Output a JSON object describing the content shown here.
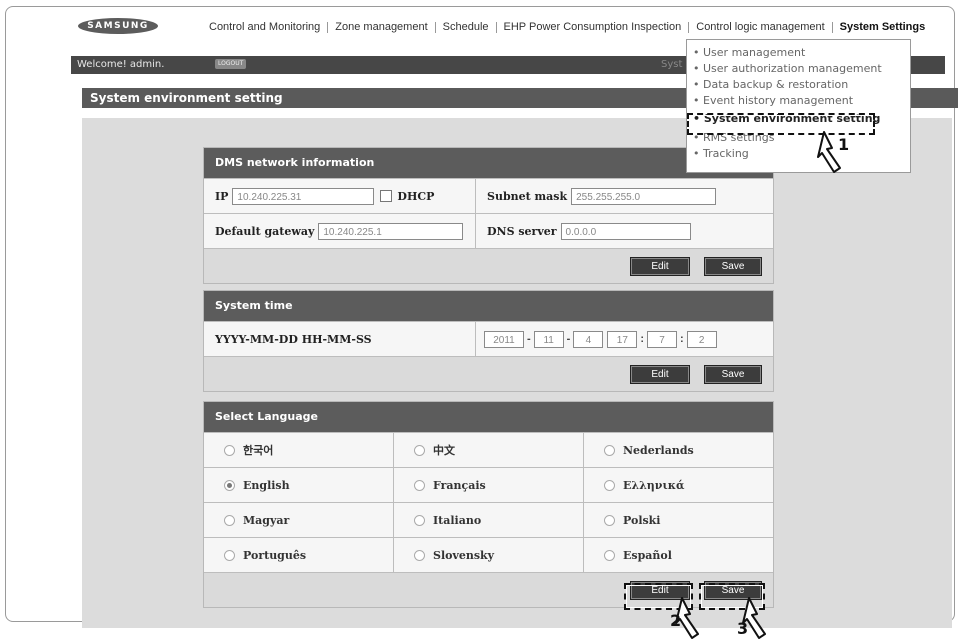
{
  "brand": {
    "logo": "SAMSUNG"
  },
  "nav": {
    "items": [
      "Control and Monitoring",
      "Zone management",
      "Schedule",
      "EHP Power Consumption Inspection",
      "Control logic management",
      "System Settings"
    ]
  },
  "session": {
    "welcome": "Welcome! admin.",
    "logout": "LOGOUT",
    "right_text": "Syst"
  },
  "page_title": "System environment setting",
  "dropdown": {
    "items": [
      "User management",
      "User authorization management",
      "Data backup & restoration",
      "Event history management",
      "System environment setting",
      "RMS settings",
      "Tracking"
    ]
  },
  "network": {
    "title": "DMS network information",
    "ip_label": "IP",
    "ip_value": "10.240.225.31",
    "dhcp_label": "DHCP",
    "subnet_label": "Subnet mask",
    "subnet_value": "255.255.255.0",
    "gateway_label": "Default gateway",
    "gateway_value": "10.240.225.1",
    "dns_label": "DNS server",
    "dns_value": "0.0.0.0",
    "edit_label": "Edit",
    "save_label": "Save"
  },
  "time": {
    "title": "System time",
    "format_label": "YYYY-MM-DD HH-MM-SS",
    "year": "2011",
    "month": "11",
    "day": "4",
    "hour": "17",
    "minute": "7",
    "second": "2",
    "dash": "-",
    "colon": ":",
    "edit_label": "Edit",
    "save_label": "Save"
  },
  "language": {
    "title": "Select Language",
    "options": [
      "한국어",
      "中文",
      "Nederlands",
      "English",
      "Français",
      "Ελληνικά",
      "Magyar",
      "Italiano",
      "Polski",
      "Português",
      "Slovensky",
      "Español"
    ],
    "selected": "English",
    "edit_label": "Edit",
    "save_label": "Save"
  },
  "callouts": [
    "1",
    "2",
    "3"
  ]
}
